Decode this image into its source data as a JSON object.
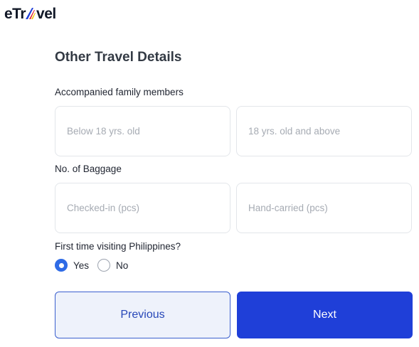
{
  "brand": {
    "prefix": "eTr",
    "suffix": "vel"
  },
  "form": {
    "title": "Other Travel Details",
    "family": {
      "label": "Accompanied family members",
      "below_placeholder": "Below 18 yrs. old",
      "above_placeholder": "18 yrs. old and above"
    },
    "baggage": {
      "label": "No. of Baggage",
      "checked_placeholder": "Checked-in (pcs)",
      "hand_placeholder": "Hand-carried (pcs)"
    },
    "first_time": {
      "label": "First time visiting Philippines?",
      "options": [
        {
          "label": "Yes",
          "selected": true
        },
        {
          "label": "No",
          "selected": false
        }
      ]
    }
  },
  "buttons": {
    "previous": "Previous",
    "next": "Next"
  },
  "colors": {
    "primary": "#1f3fd8",
    "radio_selected": "#2f6be6",
    "secondary_bg": "#eef2fb"
  }
}
